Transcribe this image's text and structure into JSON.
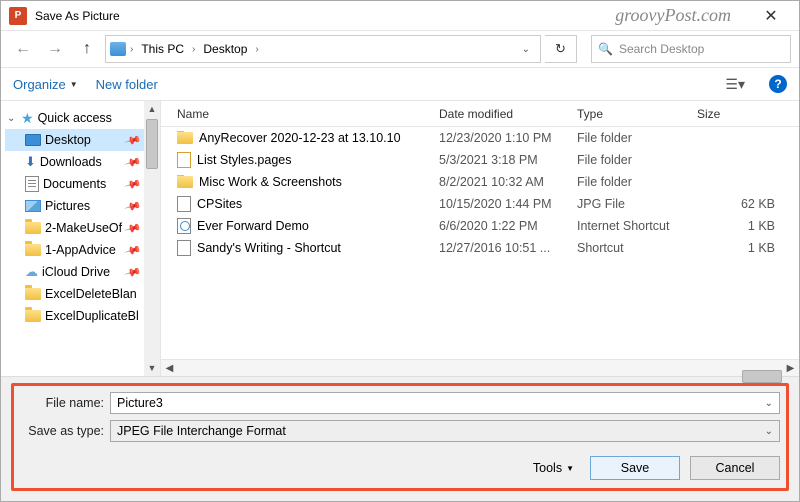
{
  "window": {
    "title": "Save As Picture",
    "watermark": "groovyPost.com"
  },
  "address": {
    "segments": [
      "This PC",
      "Desktop"
    ]
  },
  "search": {
    "placeholder": "Search Desktop"
  },
  "toolbar": {
    "organize": "Organize",
    "newfolder": "New folder"
  },
  "tree": {
    "quick": "Quick access",
    "items": [
      {
        "label": "Desktop",
        "kind": "desktop",
        "pin": true,
        "sel": true
      },
      {
        "label": "Downloads",
        "kind": "dl",
        "pin": true
      },
      {
        "label": "Documents",
        "kind": "doc",
        "pin": true
      },
      {
        "label": "Pictures",
        "kind": "pic",
        "pin": true
      },
      {
        "label": "2-MakeUseOf",
        "kind": "folder",
        "pin": true
      },
      {
        "label": "1-AppAdvice",
        "kind": "folder",
        "pin": true
      },
      {
        "label": "iCloud Drive",
        "kind": "cloud",
        "pin": true
      },
      {
        "label": "ExcelDeleteBlan",
        "kind": "folder"
      },
      {
        "label": "ExcelDuplicateBl",
        "kind": "folder"
      }
    ]
  },
  "columns": {
    "name": "Name",
    "date": "Date modified",
    "type": "Type",
    "size": "Size"
  },
  "files": [
    {
      "name": "AnyRecover 2020-12-23 at 13.10.10",
      "date": "12/23/2020 1:10 PM",
      "type": "File folder",
      "size": "",
      "kind": "folder"
    },
    {
      "name": "List Styles.pages",
      "date": "5/3/2021 3:18 PM",
      "type": "File folder",
      "size": "",
      "kind": "pages"
    },
    {
      "name": "Misc Work & Screenshots",
      "date": "8/2/2021 10:32 AM",
      "type": "File folder",
      "size": "",
      "kind": "folder"
    },
    {
      "name": "CPSites",
      "date": "10/15/2020 1:44 PM",
      "type": "JPG File",
      "size": "62 KB",
      "kind": "jpg"
    },
    {
      "name": "Ever Forward Demo",
      "date": "6/6/2020 1:22 PM",
      "type": "Internet Shortcut",
      "size": "1 KB",
      "kind": "url"
    },
    {
      "name": "Sandy's Writing - Shortcut",
      "date": "12/27/2016 10:51 ...",
      "type": "Shortcut",
      "size": "1 KB",
      "kind": "lnk"
    }
  ],
  "form": {
    "filename_label": "File name:",
    "filename_value": "Picture3",
    "saveastype_label": "Save as type:",
    "saveastype_value": "JPEG File Interchange Format",
    "tools": "Tools",
    "save": "Save",
    "cancel": "Cancel"
  }
}
